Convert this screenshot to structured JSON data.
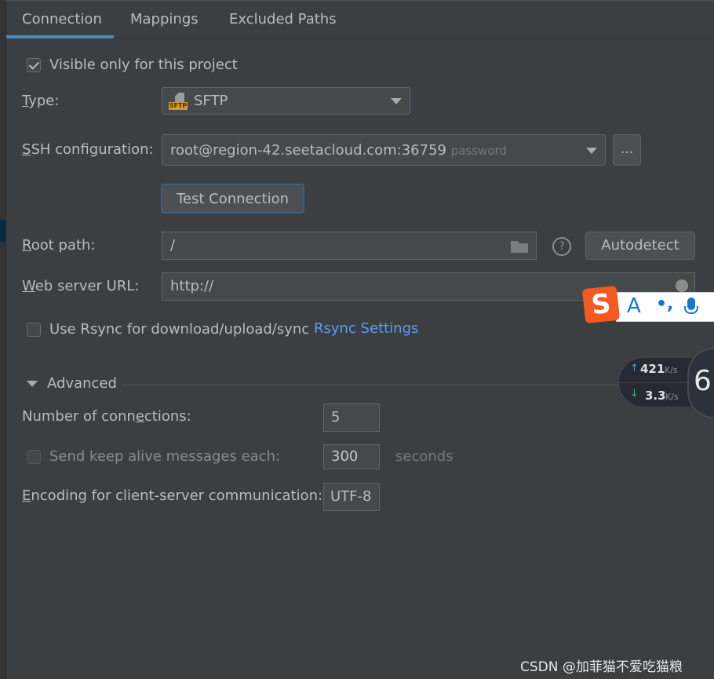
{
  "tabs": [
    {
      "label": "Connection",
      "active": true
    },
    {
      "label": "Mappings"
    },
    {
      "label": "Excluded Paths"
    }
  ],
  "visible_only": {
    "label": "Visible only for this project",
    "checked": true
  },
  "type": {
    "label_mn": "T",
    "label_rest": "ype:",
    "value": "SFTP",
    "icon": "sftp-icon"
  },
  "ssh": {
    "label_mn": "S",
    "label_rest": "SH configuration:",
    "value": "root@region-42.seetacloud.com:36759",
    "auth": "password",
    "more": "..."
  },
  "test_connection": "Test Connection",
  "root_path": {
    "label_mn": "R",
    "label_rest": "oot path:",
    "value": "/",
    "autodetect": "Autodetect",
    "help": "?"
  },
  "web_url": {
    "label_mn": "W",
    "label_rest": "eb server URL:",
    "value": "http://"
  },
  "rsync": {
    "label": "Use Rsync for download/upload/sync",
    "checked": false,
    "settings_link": "Rsync Settings"
  },
  "advanced": {
    "title": "Advanced",
    "expanded": true,
    "connections": {
      "label_a": "Number of conn",
      "label_mn": "e",
      "label_b": "ctions:",
      "value": "5"
    },
    "keepalive": {
      "label": "Send keep alive messages each:",
      "checked": false,
      "value": "300",
      "unit": "seconds"
    },
    "encoding": {
      "label_mn": "E",
      "label_rest": "ncoding for client-server communication:",
      "value": "UTF-8"
    }
  },
  "ime_toolbar": {
    "logo": "S",
    "mode": "A",
    "punct": "•,"
  },
  "net_meter": {
    "up": "421",
    "up_unit": "K/s",
    "down": "3.3",
    "down_unit": "K/s",
    "gauge": "6"
  },
  "watermark": "CSDN @加菲猫不爱吃猫粮",
  "colors": {
    "accent": "#4a88c7",
    "link": "#589df6",
    "sogou": "#f25a22",
    "background": "#3c3f41"
  }
}
